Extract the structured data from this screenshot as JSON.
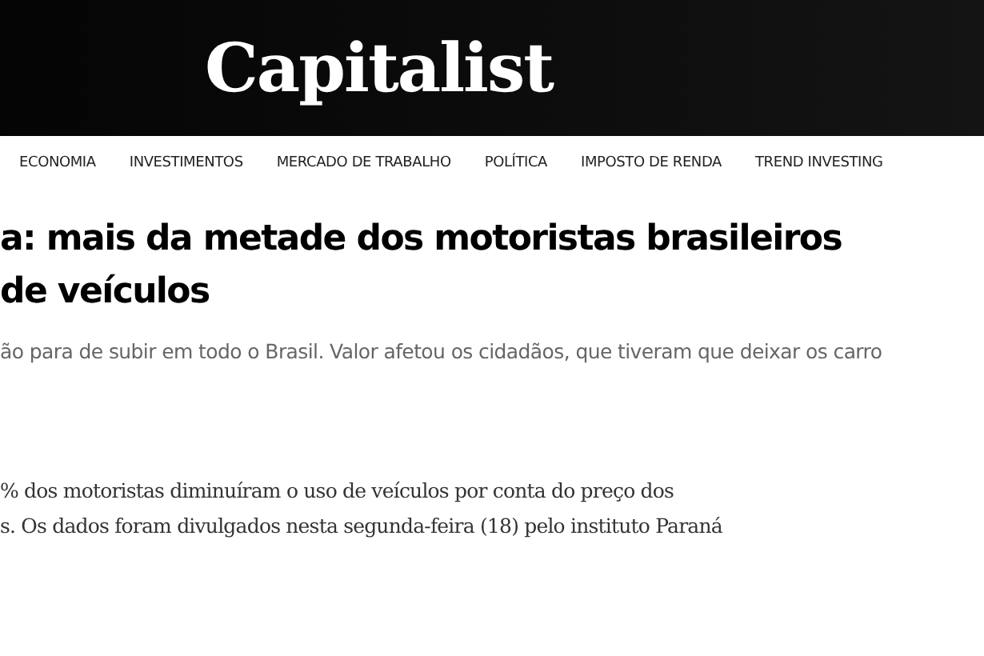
{
  "header": {
    "logo": "Capitalist"
  },
  "nav": {
    "items": [
      {
        "label": "ECONOMIA"
      },
      {
        "label": "INVESTIMENTOS"
      },
      {
        "label": "MERCADO DE TRABALHO"
      },
      {
        "label": "POLÍTICA"
      },
      {
        "label": "IMPOSTO DE RENDA"
      },
      {
        "label": "TREND INVESTING"
      }
    ]
  },
  "article": {
    "headline_lines": [
      "a: mais da metade dos motoristas brasileiros",
      "de veículos"
    ],
    "subtitle": "ão para de subir em todo o Brasil. Valor afetou os cidadãos, que tiveram que deixar os carro",
    "body_lines": [
      "% dos motoristas diminuíram o uso de veículos por conta do preço dos",
      "s. Os dados foram divulgados nesta segunda-feira (18) pelo instituto Paraná"
    ]
  }
}
